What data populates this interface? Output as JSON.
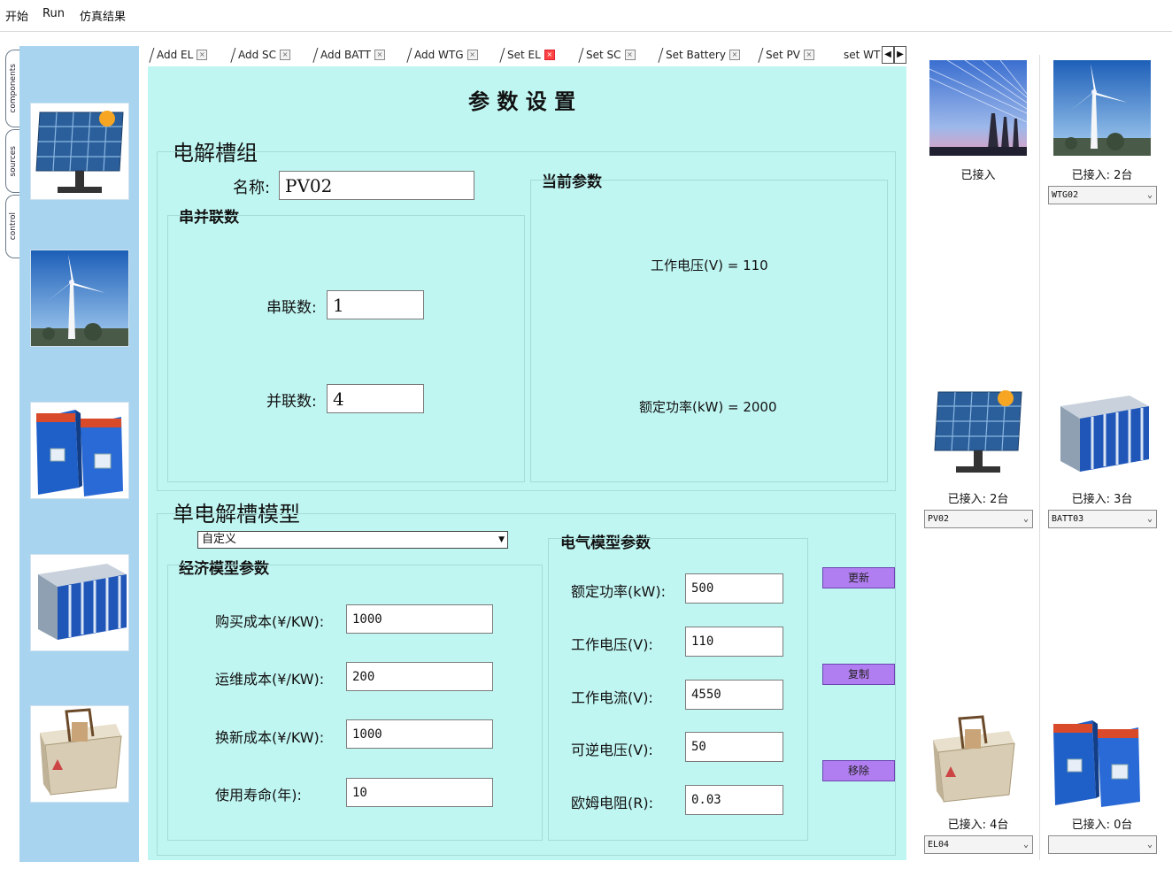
{
  "menu": [
    "开始",
    "Run",
    "仿真结果"
  ],
  "side_tabs": [
    "components",
    "sources",
    "control"
  ],
  "palette": [
    {
      "icon": "solar-panel-icon"
    },
    {
      "icon": "wind-turbine-icon"
    },
    {
      "icon": "battery-pack-icon"
    },
    {
      "icon": "container-battery-icon"
    },
    {
      "icon": "electrolyzer-icon"
    }
  ],
  "tabs": [
    {
      "label": "Add EL",
      "active": false
    },
    {
      "label": "Add SC",
      "active": false
    },
    {
      "label": "Add BATT",
      "active": false
    },
    {
      "label": "Add WTG",
      "active": false
    },
    {
      "label": "Set EL",
      "active": true
    },
    {
      "label": "Set SC",
      "active": false
    },
    {
      "label": "Set Battery",
      "active": false
    },
    {
      "label": "Set PV",
      "active": false
    },
    {
      "label": "set WT",
      "active": false
    }
  ],
  "panel_title": "参 数 设 置",
  "group1": {
    "title": "电解槽组",
    "name_label": "名称:",
    "name_value": "PV02",
    "series_parallel": {
      "title": "串并联数",
      "series_label": "串联数:",
      "series_value": "1",
      "parallel_label": "并联数:",
      "parallel_value": "4"
    },
    "current_params": {
      "title": "当前参数",
      "voltage": "工作电压(V) = 110",
      "power": "额定功率(kW) = 2000"
    }
  },
  "group2": {
    "title": "单电解槽模型",
    "model_select": "自定义",
    "economic": {
      "title": "经济模型参数",
      "fields": [
        {
          "label": "购买成本(¥/KW):",
          "value": "1000"
        },
        {
          "label": "运维成本(¥/KW):",
          "value": "200"
        },
        {
          "label": "换新成本(¥/KW):",
          "value": "1000"
        },
        {
          "label": "使用寿命(年):",
          "value": "10"
        }
      ]
    },
    "electrical": {
      "title": "电气模型参数",
      "fields": [
        {
          "label": "额定功率(kW):",
          "value": "500"
        },
        {
          "label": "工作电压(V):",
          "value": "110"
        },
        {
          "label": "工作电流(V):",
          "value": "4550"
        },
        {
          "label": "可逆电压(V):",
          "value": "50"
        },
        {
          "label": "欧姆电阻(R):",
          "value": "0.03"
        }
      ]
    }
  },
  "buttons": [
    "更新",
    "复制",
    "移除"
  ],
  "gallery": [
    {
      "icon": "power-grid-icon",
      "label": "已接入",
      "select": ""
    },
    {
      "icon": "wind-turbine-icon",
      "label": "已接入: 2台",
      "select": "WTG02"
    },
    {
      "icon": "solar-panel-icon",
      "label": "已接入: 2台",
      "select": "PV02"
    },
    {
      "icon": "container-battery-icon",
      "label": "已接入: 3台",
      "select": "BATT03"
    },
    {
      "icon": "electrolyzer-icon",
      "label": "已接入: 4台",
      "select": "EL04"
    },
    {
      "icon": "battery-pack-icon",
      "label": "已接入: 0台",
      "select": ""
    }
  ],
  "colors": {
    "panel_bg": "#c0f6f2",
    "palette_bg": "#a8d4f0",
    "button_bg": "#b07ef0"
  }
}
